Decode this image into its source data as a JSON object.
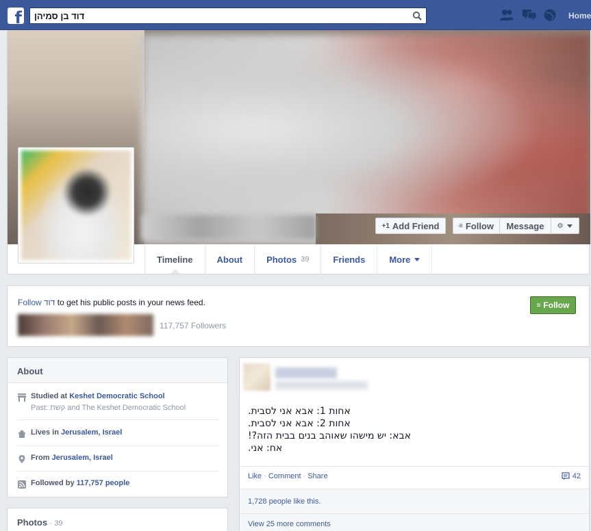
{
  "topbar": {
    "search_value": "דוד בן סמיהן",
    "home_label": "Home"
  },
  "profile": {
    "add_friend_label": "Add Friend",
    "follow_label": "Follow",
    "message_label": "Message"
  },
  "tabs": [
    {
      "label": "Timeline"
    },
    {
      "label": "About"
    },
    {
      "label": "Photos",
      "count": "39"
    },
    {
      "label": "Friends"
    },
    {
      "label": "More"
    }
  ],
  "follow_box": {
    "follow_link": "Follow",
    "name": "דוד",
    "suffix": " to get his public posts in your news feed.",
    "followers_count": "117,757 Followers",
    "follow_button": "Follow"
  },
  "about": {
    "title": "About",
    "studied_prefix": "Studied at ",
    "studied_school": "Keshet Democratic School",
    "past_label": "Past: ",
    "past_school_1": "קשת",
    "past_and": " and ",
    "past_school_2": "The Keshet Democratic School",
    "lives_prefix": "Lives in ",
    "lives_place": "Jerusalem, Israel",
    "from_prefix": "From ",
    "from_place": "Jerusalem, Israel",
    "followed_prefix": "Followed by ",
    "followed_count": "117,757 people"
  },
  "photos_box": {
    "title": "Photos",
    "count": "39"
  },
  "post": {
    "lines": [
      "אחות 1: אבא אני לסבית.",
      "אחות 2: אבא אני לסבית.",
      "אבא: יש מישהו שאוהב בנים בבית הזה?!",
      "אח: אני."
    ],
    "like": "Like",
    "comment": "Comment",
    "share": "Share",
    "comment_count": "42",
    "likes_text": "1,728 people like this.",
    "more_comments": "View 25 more comments"
  }
}
